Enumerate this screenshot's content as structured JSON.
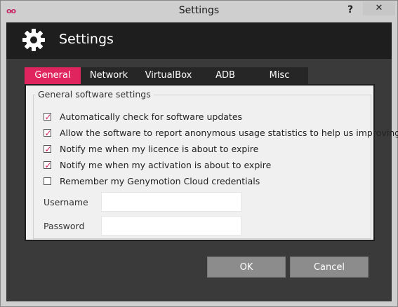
{
  "window": {
    "title": "Settings",
    "help_glyph": "?",
    "close_glyph": "✕",
    "app_icon_glyph": "oo"
  },
  "header": {
    "title": "Settings",
    "icon": "gear-icon"
  },
  "tabs": [
    {
      "label": "General",
      "active": true
    },
    {
      "label": "Network",
      "active": false
    },
    {
      "label": "VirtualBox",
      "active": false
    },
    {
      "label": "ADB",
      "active": false
    },
    {
      "label": "Misc",
      "active": false
    }
  ],
  "general": {
    "group_title": "General software settings",
    "checkboxes": [
      {
        "label": "Automatically check for software updates",
        "checked": true
      },
      {
        "label": "Allow the software to report anonymous usage statistics to help us improving",
        "checked": true
      },
      {
        "label": "Notify me when my licence is about to expire",
        "checked": true
      },
      {
        "label": "Notify me when my activation is about to expire",
        "checked": true
      },
      {
        "label": "Remember my Genymotion Cloud credentials",
        "checked": false
      }
    ],
    "username": {
      "label": "Username",
      "value": ""
    },
    "password": {
      "label": "Password",
      "value": ""
    }
  },
  "buttons": {
    "ok": "OK",
    "cancel": "Cancel"
  },
  "colors": {
    "accent": "#e0245e",
    "header_bg": "#1e1e1e",
    "client_bg": "#3a3a3a",
    "button_bg": "#8c8c8c"
  }
}
